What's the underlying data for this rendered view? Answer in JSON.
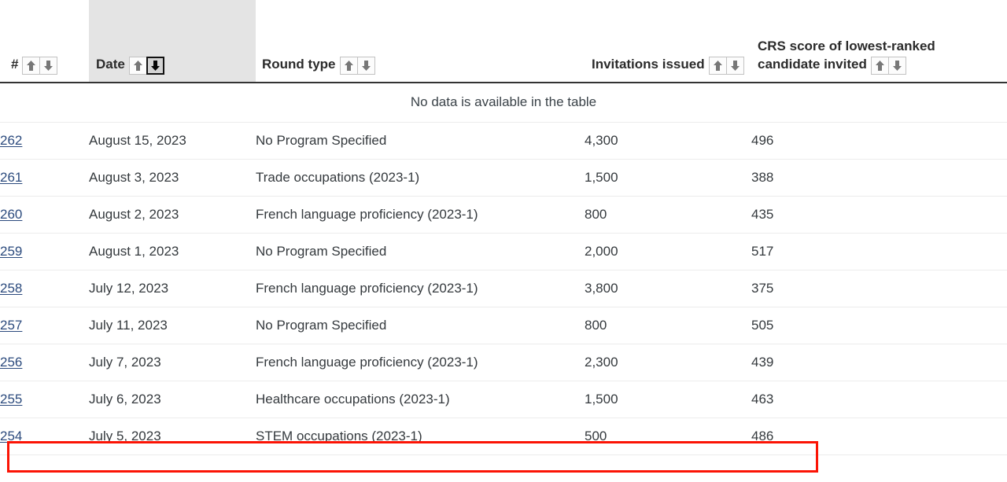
{
  "table": {
    "columns": [
      {
        "key": "num",
        "label": "#",
        "sort": "none"
      },
      {
        "key": "date",
        "label": "Date",
        "sort": "desc"
      },
      {
        "key": "type",
        "label": "Round type",
        "sort": "none"
      },
      {
        "key": "inv",
        "label": "Invitations issued",
        "sort": "none"
      },
      {
        "key": "crs",
        "label": "CRS score of lowest-ranked candidate invited",
        "sort": "none"
      }
    ],
    "headers": {
      "num": "#",
      "date": "Date",
      "type": "Round type",
      "invitations": "Invitations issued",
      "crs": "CRS score of lowest-ranked candidate invited"
    },
    "empty_message": "No data is available in the table",
    "sort_ascending_title": "Sort ascending",
    "sort_descending_title": "Sort descending",
    "rows": [
      {
        "num": "262",
        "date": "August 15, 2023",
        "type": "No Program Specified",
        "invitations": "4,300",
        "crs": "496",
        "highlighted": false
      },
      {
        "num": "261",
        "date": "August 3, 2023",
        "type": "Trade occupations (2023-1)",
        "invitations": "1,500",
        "crs": "388",
        "highlighted": false
      },
      {
        "num": "260",
        "date": "August 2, 2023",
        "type": "French language proficiency (2023-1)",
        "invitations": "800",
        "crs": "435",
        "highlighted": false
      },
      {
        "num": "259",
        "date": "August 1, 2023",
        "type": "No Program Specified",
        "invitations": "2,000",
        "crs": "517",
        "highlighted": false
      },
      {
        "num": "258",
        "date": "July 12, 2023",
        "type": "French language proficiency (2023-1)",
        "invitations": "3,800",
        "crs": "375",
        "highlighted": false
      },
      {
        "num": "257",
        "date": "July 11, 2023",
        "type": "No Program Specified",
        "invitations": "800",
        "crs": "505",
        "highlighted": false
      },
      {
        "num": "256",
        "date": "July 7, 2023",
        "type": "French language proficiency (2023-1)",
        "invitations": "2,300",
        "crs": "439",
        "highlighted": false
      },
      {
        "num": "255",
        "date": "July 6, 2023",
        "type": "Healthcare occupations (2023-1)",
        "invitations": "1,500",
        "crs": "463",
        "highlighted": false
      },
      {
        "num": "254",
        "date": "July 5, 2023",
        "type": "STEM occupations (2023-1)",
        "invitations": "500",
        "crs": "486",
        "highlighted": true
      }
    ]
  },
  "colors": {
    "link": "#2b4a7d",
    "highlight_border": "#fb1405",
    "active_column_bg": "#e4e4e4",
    "header_rule": "#333333",
    "row_rule": "#ececec"
  },
  "icons": {
    "sort_up": "arrow-up-icon",
    "sort_down": "arrow-down-icon"
  }
}
